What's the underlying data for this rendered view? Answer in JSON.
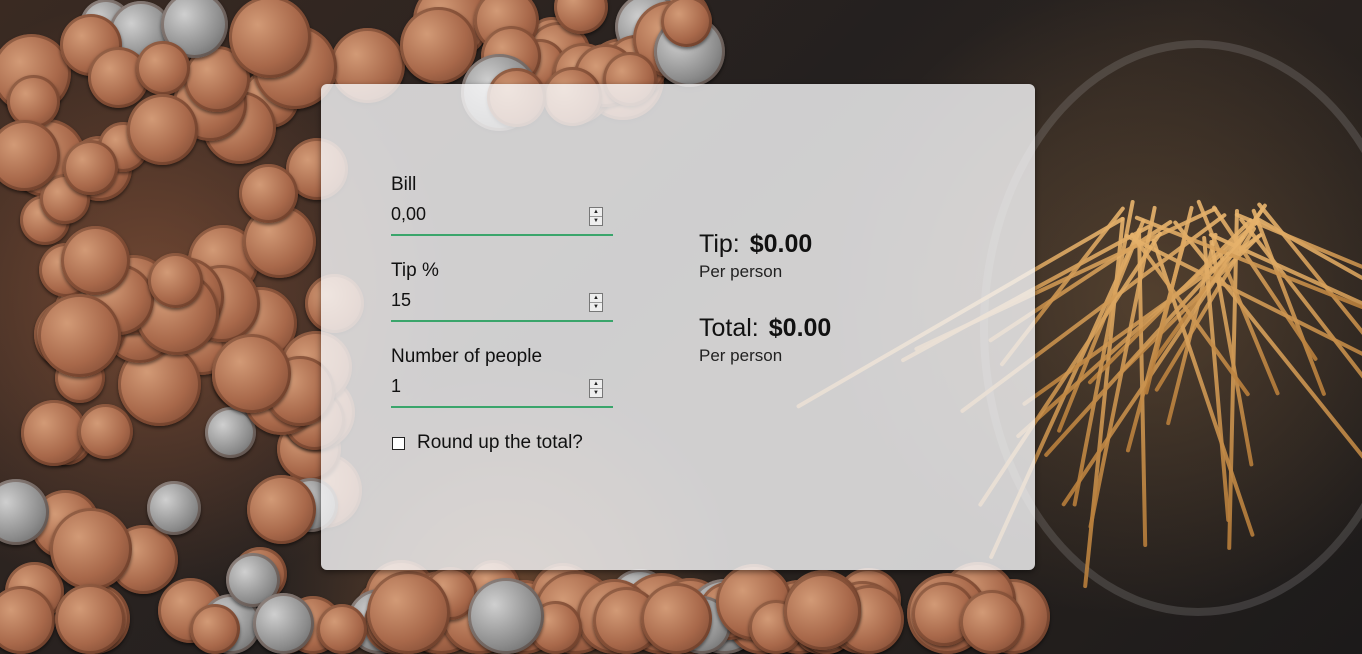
{
  "form": {
    "bill": {
      "label": "Bill",
      "value": "0,00"
    },
    "tip_percent": {
      "label": "Tip %",
      "value": "15"
    },
    "people": {
      "label": "Number of people",
      "value": "1"
    },
    "round_up": {
      "label": "Round up the total?",
      "checked": false
    }
  },
  "results": {
    "tip": {
      "label": "Tip:",
      "amount": "$0.00",
      "sub": "Per person"
    },
    "total": {
      "label": "Total:",
      "amount": "$0.00",
      "sub": "Per person"
    }
  },
  "icons": {
    "spinner_up": "triangle-up-icon",
    "spinner_down": "triangle-down-icon"
  },
  "colors": {
    "input_underline": "#3aa56b",
    "card_background": "#f5f5f7"
  }
}
